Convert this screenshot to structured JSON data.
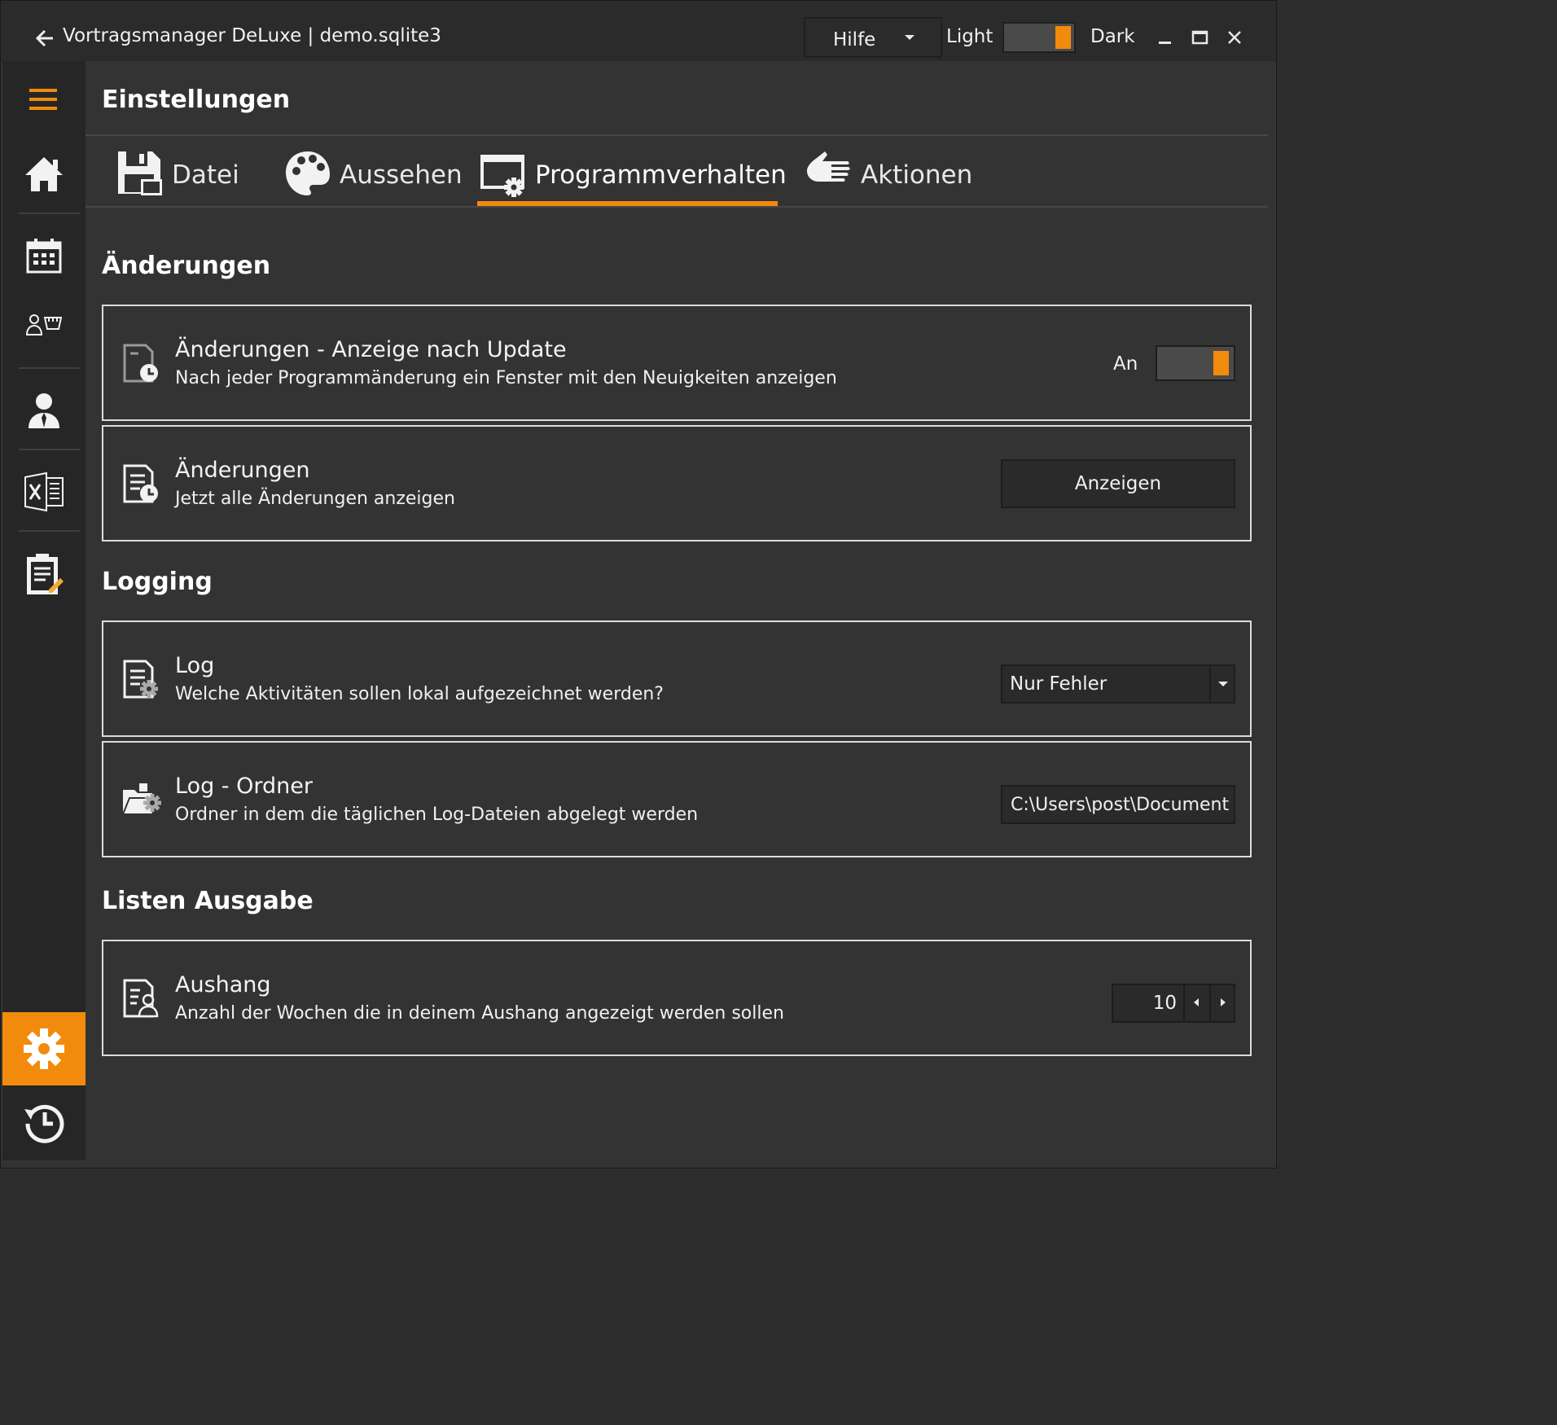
{
  "app": {
    "title": "Vortragsmanager DeLuxe | demo.sqlite3",
    "help_label": "Hilfe",
    "theme_light": "Light",
    "theme_dark": "Dark",
    "accent_color": "#f28b0b"
  },
  "page": {
    "title": "Einstellungen"
  },
  "tabs": [
    {
      "label": "Datei",
      "icon": "save-icon",
      "active": false
    },
    {
      "label": "Aussehen",
      "icon": "palette-icon",
      "active": false
    },
    {
      "label": "Programmverhalten",
      "icon": "window-gear-icon",
      "active": true
    },
    {
      "label": "Aktionen",
      "icon": "hand-icon",
      "active": false
    }
  ],
  "sidebar": {
    "items": [
      {
        "name": "menu",
        "icon": "hamburger-icon"
      },
      {
        "name": "home",
        "icon": "home-icon"
      },
      {
        "name": "calendar",
        "icon": "calendar-icon"
      },
      {
        "name": "speakers",
        "icon": "speaker-icon"
      },
      {
        "name": "person",
        "icon": "person-icon"
      },
      {
        "name": "excel",
        "icon": "excel-icon"
      },
      {
        "name": "clipboard",
        "icon": "clipboard-icon"
      },
      {
        "name": "settings",
        "icon": "gear-icon",
        "active": true
      },
      {
        "name": "history",
        "icon": "history-icon"
      }
    ]
  },
  "sections": {
    "changes": {
      "title": "Änderungen",
      "update_display": {
        "title": "Änderungen - Anzeige nach Update",
        "description": "Nach jeder Programmänderung ein Fenster mit den Neuigkeiten anzeigen",
        "toggle_label": "An",
        "toggle_on": true
      },
      "show_all": {
        "title": "Änderungen",
        "description": "Jetzt alle Änderungen anzeigen",
        "button_label": "Anzeigen"
      }
    },
    "logging": {
      "title": "Logging",
      "log_level": {
        "title": "Log",
        "description": "Welche Aktivitäten sollen lokal aufgezeichnet werden?",
        "selected": "Nur Fehler"
      },
      "log_folder": {
        "title": "Log - Ordner",
        "description": "Ordner in dem die täglichen Log-Dateien abgelegt werden",
        "value": "C:\\Users\\post\\Document"
      }
    },
    "lists": {
      "title": "Listen Ausgabe",
      "posting": {
        "title": "Aushang",
        "description": "Anzahl der Wochen die in deinem Aushang angezeigt werden sollen",
        "value": "10"
      }
    }
  }
}
